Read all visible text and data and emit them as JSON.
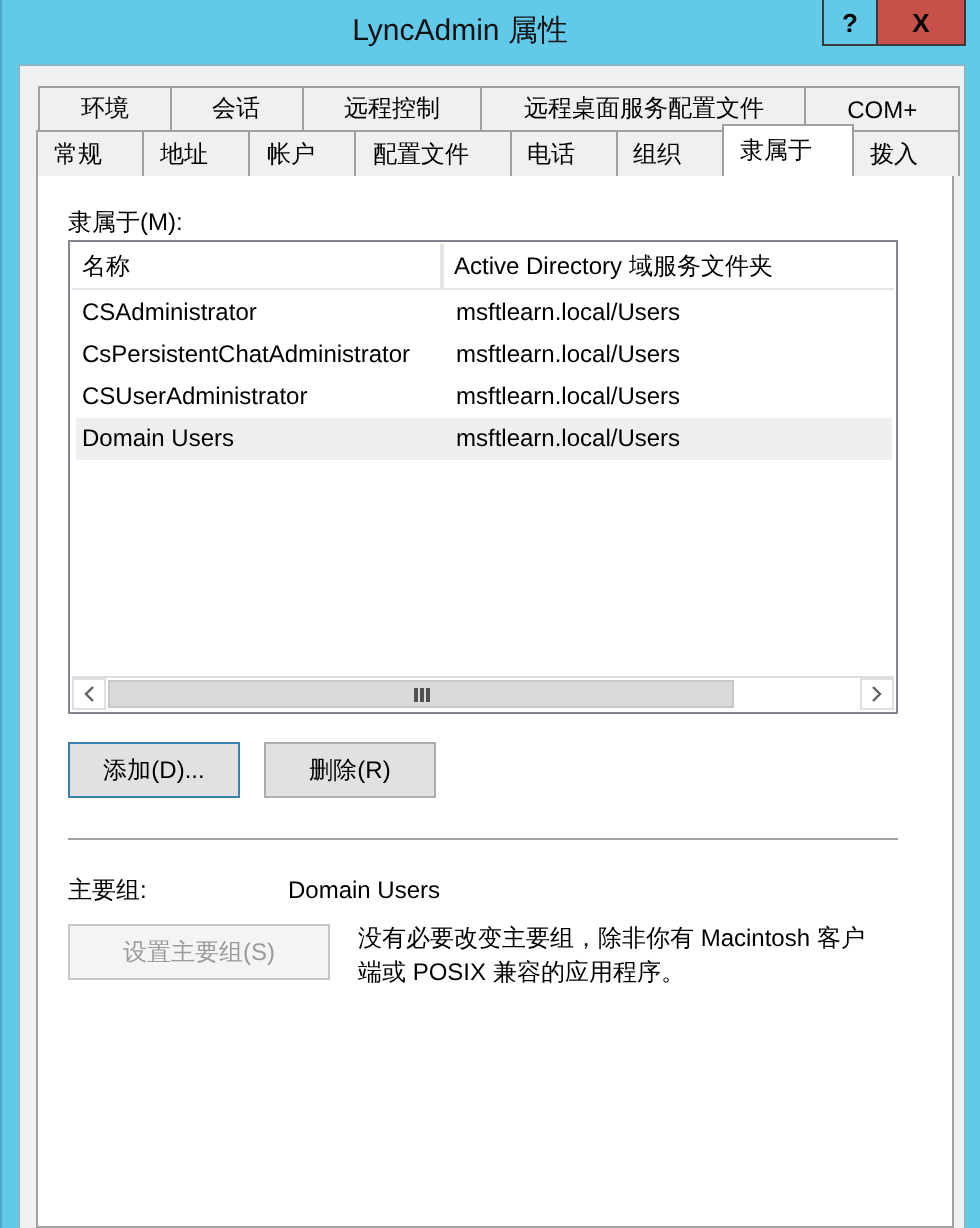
{
  "window": {
    "title": "LyncAdmin 属性",
    "buttons": [
      {
        "kind": "help",
        "label": "?"
      },
      {
        "kind": "close",
        "label": "X"
      }
    ]
  },
  "tab_rows": [
    {
      "tabs": [
        {
          "label": "环境",
          "selected": false
        },
        {
          "label": "会话",
          "selected": false
        },
        {
          "label": "远程控制",
          "selected": false
        },
        {
          "label": "远程桌面服务配置文件",
          "selected": false
        },
        {
          "label": "COM+",
          "selected": false
        }
      ]
    },
    {
      "tabs": [
        {
          "label": "常规",
          "selected": false
        },
        {
          "label": "地址",
          "selected": false
        },
        {
          "label": "帐户",
          "selected": false
        },
        {
          "label": "配置文件",
          "selected": false
        },
        {
          "label": "电话",
          "selected": false
        },
        {
          "label": "组织",
          "selected": false
        },
        {
          "label": "隶属于",
          "selected": true
        },
        {
          "label": "拨入",
          "selected": false
        }
      ]
    }
  ],
  "member_of": {
    "label": "隶属于(M):",
    "columns": [
      "名称",
      "Active Directory 域服务文件夹"
    ],
    "rows": [
      {
        "cells": [
          "CSAdministrator",
          "msftlearn.local/Users"
        ],
        "selected": false
      },
      {
        "cells": [
          "CsPersistentChatAdministrator",
          "msftlearn.local/Users"
        ],
        "selected": false
      },
      {
        "cells": [
          "CSUserAdministrator",
          "msftlearn.local/Users"
        ],
        "selected": false
      },
      {
        "cells": [
          "Domain Users",
          "msftlearn.local/Users"
        ],
        "selected": true
      }
    ],
    "buttons": [
      {
        "label": "添加(D)...",
        "default": true
      },
      {
        "label": "删除(R)",
        "default": false
      }
    ]
  },
  "primary_group": {
    "label": "主要组:",
    "value": "Domain Users",
    "button": {
      "label": "设置主要组(S)",
      "disabled": true
    },
    "note": "没有必要改变主要组，除非你有 Macintosh 客户端或 POSIX 兼容的应用程序。"
  }
}
